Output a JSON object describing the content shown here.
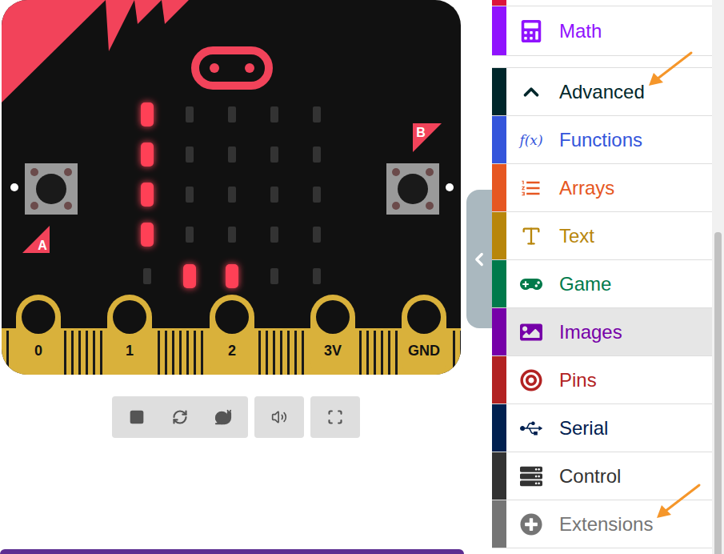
{
  "simulator": {
    "leds": [
      [
        true,
        false,
        false,
        false,
        false
      ],
      [
        true,
        false,
        false,
        false,
        false
      ],
      [
        true,
        false,
        false,
        false,
        false
      ],
      [
        true,
        false,
        false,
        false,
        false
      ],
      [
        false,
        true,
        true,
        false,
        false
      ]
    ],
    "buttons": [
      {
        "label": "A"
      },
      {
        "label": "B"
      }
    ],
    "pins": [
      "0",
      "1",
      "2",
      "3V",
      "GND"
    ]
  },
  "toolbox": {
    "categories": [
      {
        "label": "Math",
        "kind": "category",
        "color": "#9013fe",
        "selected": false,
        "annotated": false
      },
      {
        "label": "Advanced",
        "kind": "toggle",
        "expanded": true,
        "color": "#00272b",
        "selected": false,
        "annotated": true
      },
      {
        "label": "Functions",
        "kind": "category",
        "icon_text": "f(x)",
        "color": "#3455db",
        "selected": false,
        "annotated": false
      },
      {
        "label": "Arrays",
        "kind": "category",
        "color": "#e65722",
        "selected": false,
        "annotated": false
      },
      {
        "label": "Text",
        "kind": "category",
        "color": "#b8860b",
        "selected": false,
        "annotated": false
      },
      {
        "label": "Game",
        "kind": "category",
        "color": "#007a4b",
        "selected": false,
        "annotated": false
      },
      {
        "label": "Images",
        "kind": "category",
        "color": "#7600a8",
        "selected": true,
        "annotated": false
      },
      {
        "label": "Pins",
        "kind": "category",
        "color": "#b22222",
        "selected": false,
        "annotated": false
      },
      {
        "label": "Serial",
        "kind": "category",
        "color": "#002050",
        "selected": false,
        "annotated": false
      },
      {
        "label": "Control",
        "kind": "category",
        "color": "#333333",
        "selected": false,
        "annotated": false
      },
      {
        "label": "Extensions",
        "kind": "category",
        "color": "#757575",
        "selected": false,
        "annotated": true
      }
    ]
  }
}
